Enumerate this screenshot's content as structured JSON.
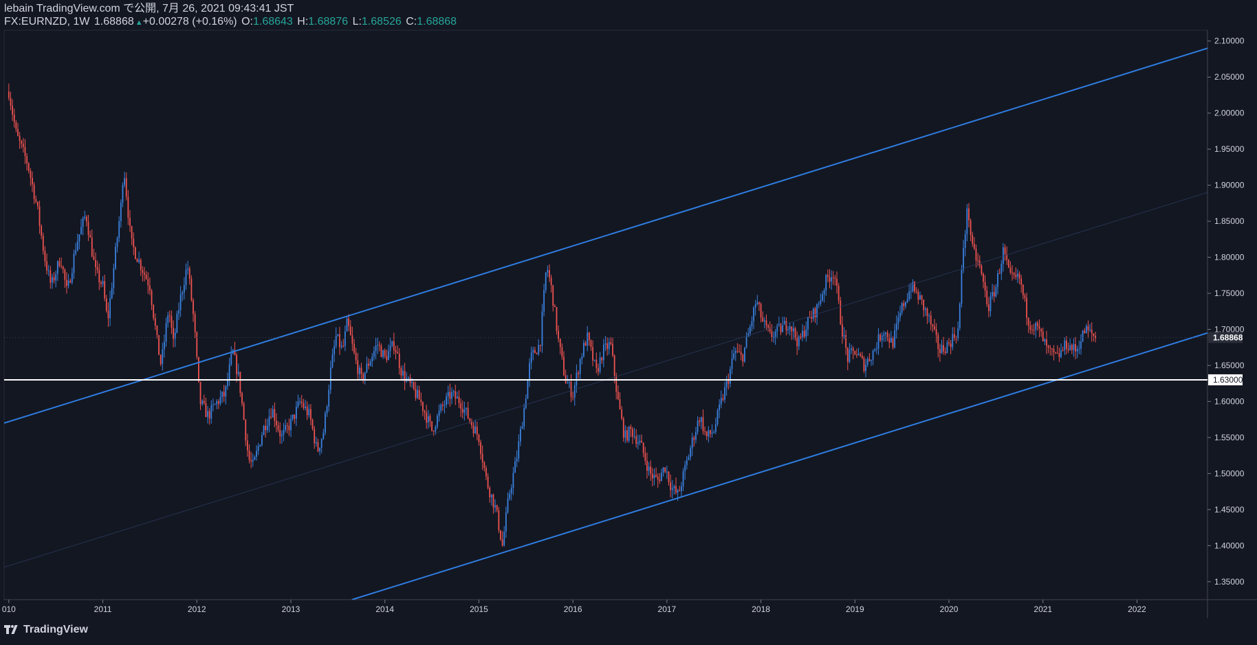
{
  "header": {
    "publish_line": "lebain TradingView.com で公開, 7月 26, 2021 09:43:41 JST",
    "symbol": "FX:EURNZD, 1W",
    "last": "1.68868",
    "change_arrow": "▲",
    "change": "+0.00278 (+0.16%)",
    "o_label": "O:",
    "o_value": "1.68643",
    "h_label": "H:",
    "h_value": "1.68876",
    "l_label": "L:",
    "l_value": "1.68526",
    "c_label": "C:",
    "c_value": "1.68868"
  },
  "footer": {
    "brand": "TradingView",
    "logo_icon": "tradingview-logo-icon"
  },
  "colors": {
    "background": "#131722",
    "up": "#3a82e0",
    "down": "#ef5350",
    "channel": "#2f7de1",
    "support": "#ffffff",
    "text": "#d1d4dc"
  },
  "chart_data": {
    "type": "candlestick",
    "symbol": "FX:EURNZD",
    "timeframe": "1W",
    "x_tick_labels": [
      "010",
      "2011",
      "2012",
      "2013",
      "2014",
      "2015",
      "2016",
      "2017",
      "2018",
      "2019",
      "2020",
      "2021",
      "2022"
    ],
    "x_tick_years": [
      2010.0,
      2011.0,
      2012.0,
      2013.0,
      2014.0,
      2015.0,
      2016.0,
      2017.0,
      2018.0,
      2019.0,
      2020.0,
      2021.0,
      2022.0
    ],
    "y_tick_labels": [
      "2.10000",
      "2.05000",
      "2.00000",
      "1.95000",
      "1.90000",
      "1.85000",
      "1.80000",
      "1.75000",
      "1.70000",
      "1.65000",
      "1.60000",
      "1.55000",
      "1.50000",
      "1.45000",
      "1.40000",
      "1.35000"
    ],
    "y_range": [
      1.325,
      2.115
    ],
    "last_price_label": "1.68868",
    "support_label": "1.63000",
    "support_level": 1.63,
    "channel_upper": [
      [
        2009.95,
        1.57
      ],
      [
        2022.75,
        2.09
      ]
    ],
    "channel_lower": [
      [
        2013.65,
        1.325
      ],
      [
        2022.75,
        1.695
      ]
    ],
    "channel_mid": [
      [
        2009.95,
        1.37
      ],
      [
        2022.75,
        1.89
      ]
    ],
    "price_path": [
      [
        2010.0,
        2.03
      ],
      [
        2010.08,
        1.97
      ],
      [
        2010.2,
        1.93
      ],
      [
        2010.3,
        1.87
      ],
      [
        2010.38,
        1.8
      ],
      [
        2010.45,
        1.76
      ],
      [
        2010.55,
        1.8
      ],
      [
        2010.62,
        1.75
      ],
      [
        2010.72,
        1.82
      ],
      [
        2010.82,
        1.86
      ],
      [
        2010.92,
        1.78
      ],
      [
        2011.0,
        1.76
      ],
      [
        2011.05,
        1.71
      ],
      [
        2011.12,
        1.79
      ],
      [
        2011.2,
        1.88
      ],
      [
        2011.22,
        1.93
      ],
      [
        2011.3,
        1.82
      ],
      [
        2011.4,
        1.79
      ],
      [
        2011.5,
        1.76
      ],
      [
        2011.58,
        1.68
      ],
      [
        2011.62,
        1.65
      ],
      [
        2011.7,
        1.73
      ],
      [
        2011.75,
        1.68
      ],
      [
        2011.82,
        1.74
      ],
      [
        2011.9,
        1.79
      ],
      [
        2011.97,
        1.71
      ],
      [
        2012.03,
        1.6
      ],
      [
        2012.12,
        1.58
      ],
      [
        2012.22,
        1.6
      ],
      [
        2012.3,
        1.61
      ],
      [
        2012.38,
        1.67
      ],
      [
        2012.45,
        1.63
      ],
      [
        2012.55,
        1.52
      ],
      [
        2012.6,
        1.51
      ],
      [
        2012.7,
        1.56
      ],
      [
        2012.8,
        1.59
      ],
      [
        2012.9,
        1.55
      ],
      [
        2013.0,
        1.57
      ],
      [
        2013.1,
        1.6
      ],
      [
        2013.2,
        1.58
      ],
      [
        2013.28,
        1.53
      ],
      [
        2013.35,
        1.56
      ],
      [
        2013.42,
        1.64
      ],
      [
        2013.48,
        1.69
      ],
      [
        2013.55,
        1.67
      ],
      [
        2013.6,
        1.71
      ],
      [
        2013.68,
        1.66
      ],
      [
        2013.75,
        1.63
      ],
      [
        2013.85,
        1.66
      ],
      [
        2013.92,
        1.68
      ],
      [
        2014.0,
        1.66
      ],
      [
        2014.1,
        1.68
      ],
      [
        2014.18,
        1.64
      ],
      [
        2014.28,
        1.62
      ],
      [
        2014.38,
        1.6
      ],
      [
        2014.5,
        1.56
      ],
      [
        2014.6,
        1.59
      ],
      [
        2014.7,
        1.61
      ],
      [
        2014.8,
        1.6
      ],
      [
        2014.88,
        1.58
      ],
      [
        2015.0,
        1.55
      ],
      [
        2015.08,
        1.49
      ],
      [
        2015.18,
        1.45
      ],
      [
        2015.25,
        1.4
      ],
      [
        2015.32,
        1.47
      ],
      [
        2015.4,
        1.52
      ],
      [
        2015.48,
        1.59
      ],
      [
        2015.55,
        1.66
      ],
      [
        2015.65,
        1.68
      ],
      [
        2015.72,
        1.79
      ],
      [
        2015.78,
        1.75
      ],
      [
        2015.85,
        1.68
      ],
      [
        2015.92,
        1.63
      ],
      [
        2016.0,
        1.61
      ],
      [
        2016.08,
        1.66
      ],
      [
        2016.15,
        1.69
      ],
      [
        2016.25,
        1.64
      ],
      [
        2016.32,
        1.67
      ],
      [
        2016.4,
        1.68
      ],
      [
        2016.48,
        1.6
      ],
      [
        2016.55,
        1.55
      ],
      [
        2016.62,
        1.56
      ],
      [
        2016.72,
        1.54
      ],
      [
        2016.82,
        1.5
      ],
      [
        2016.9,
        1.49
      ],
      [
        2016.98,
        1.51
      ],
      [
        2017.05,
        1.48
      ],
      [
        2017.12,
        1.47
      ],
      [
        2017.2,
        1.51
      ],
      [
        2017.28,
        1.55
      ],
      [
        2017.35,
        1.58
      ],
      [
        2017.42,
        1.55
      ],
      [
        2017.5,
        1.56
      ],
      [
        2017.58,
        1.6
      ],
      [
        2017.65,
        1.63
      ],
      [
        2017.72,
        1.67
      ],
      [
        2017.8,
        1.66
      ],
      [
        2017.88,
        1.7
      ],
      [
        2017.95,
        1.74
      ],
      [
        2018.02,
        1.71
      ],
      [
        2018.1,
        1.69
      ],
      [
        2018.2,
        1.7
      ],
      [
        2018.3,
        1.71
      ],
      [
        2018.4,
        1.68
      ],
      [
        2018.5,
        1.71
      ],
      [
        2018.6,
        1.73
      ],
      [
        2018.7,
        1.77
      ],
      [
        2018.78,
        1.78
      ],
      [
        2018.85,
        1.71
      ],
      [
        2018.92,
        1.66
      ],
      [
        2019.0,
        1.67
      ],
      [
        2019.1,
        1.65
      ],
      [
        2019.2,
        1.67
      ],
      [
        2019.3,
        1.7
      ],
      [
        2019.4,
        1.68
      ],
      [
        2019.5,
        1.73
      ],
      [
        2019.6,
        1.76
      ],
      [
        2019.7,
        1.74
      ],
      [
        2019.8,
        1.71
      ],
      [
        2019.9,
        1.67
      ],
      [
        2020.0,
        1.68
      ],
      [
        2020.1,
        1.7
      ],
      [
        2020.15,
        1.81
      ],
      [
        2020.2,
        1.87
      ],
      [
        2020.25,
        1.81
      ],
      [
        2020.32,
        1.79
      ],
      [
        2020.42,
        1.73
      ],
      [
        2020.5,
        1.76
      ],
      [
        2020.58,
        1.81
      ],
      [
        2020.65,
        1.77
      ],
      [
        2020.75,
        1.77
      ],
      [
        2020.85,
        1.71
      ],
      [
        2020.95,
        1.7
      ],
      [
        2021.05,
        1.67
      ],
      [
        2021.15,
        1.66
      ],
      [
        2021.25,
        1.68
      ],
      [
        2021.35,
        1.67
      ],
      [
        2021.45,
        1.7
      ],
      [
        2021.55,
        1.69
      ],
      [
        2021.57,
        1.68868
      ]
    ]
  }
}
